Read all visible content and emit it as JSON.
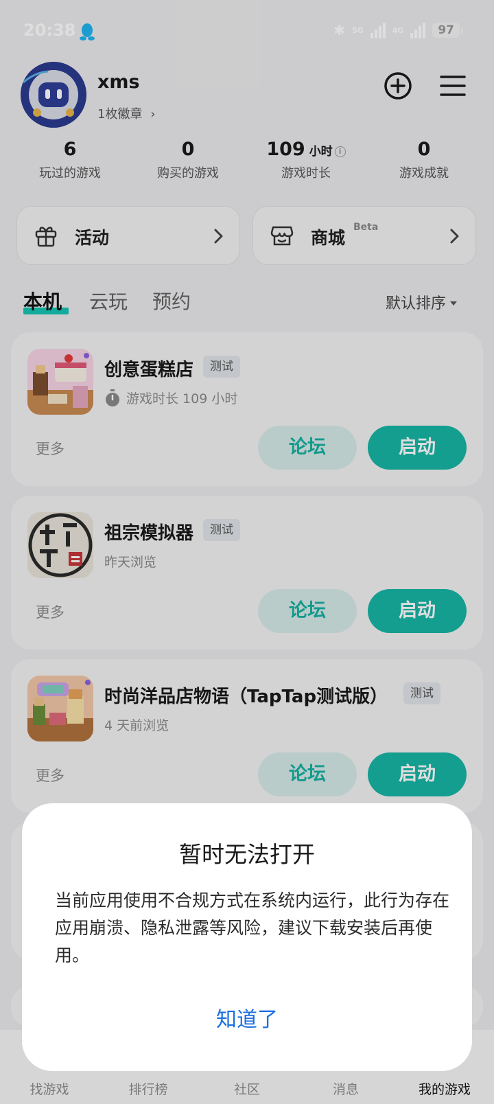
{
  "status_bar": {
    "time": "20:38",
    "net_1": "5G",
    "net_2": "4G",
    "battery": "97"
  },
  "profile": {
    "username": "xms",
    "badges": "1枚徽章"
  },
  "stats": [
    {
      "value": "6",
      "unit": "",
      "label": "玩过的游戏"
    },
    {
      "value": "0",
      "unit": "",
      "label": "购买的游戏"
    },
    {
      "value": "109",
      "unit": "小时",
      "label": "游戏时长"
    },
    {
      "value": "0",
      "unit": "",
      "label": "游戏成就"
    }
  ],
  "quick": {
    "activity": "活动",
    "store": "商城",
    "store_badge": "Beta"
  },
  "tabs": {
    "local": "本机",
    "cloud": "云玩",
    "reserve": "预约",
    "sort": "默认排序"
  },
  "games": [
    {
      "title": "创意蛋糕店",
      "tag": "测试",
      "subtitle": "游戏时长 109 小时",
      "more": "更多",
      "forum": "论坛",
      "launch": "启动"
    },
    {
      "title": "祖宗模拟器",
      "tag": "测试",
      "subtitle": "昨天浏览",
      "more": "更多",
      "forum": "论坛",
      "launch": "启动"
    },
    {
      "title": "时尚洋品店物语（TapTap测试版）",
      "tag": "测试",
      "subtitle": "4 天前浏览",
      "more": "更多",
      "forum": "论坛",
      "launch": "启动"
    }
  ],
  "nav": [
    "找游戏",
    "排行榜",
    "社区",
    "消息",
    "我的游戏"
  ],
  "dialog": {
    "title": "暂时无法打开",
    "body": "当前应用使用不合规方式在系统内运行，此行为存在应用崩溃、隐私泄露等风险，建议下载安装后再使用。",
    "confirm": "知道了"
  },
  "colors": {
    "accent": "#17b6a6",
    "link": "#1a6fe0"
  }
}
